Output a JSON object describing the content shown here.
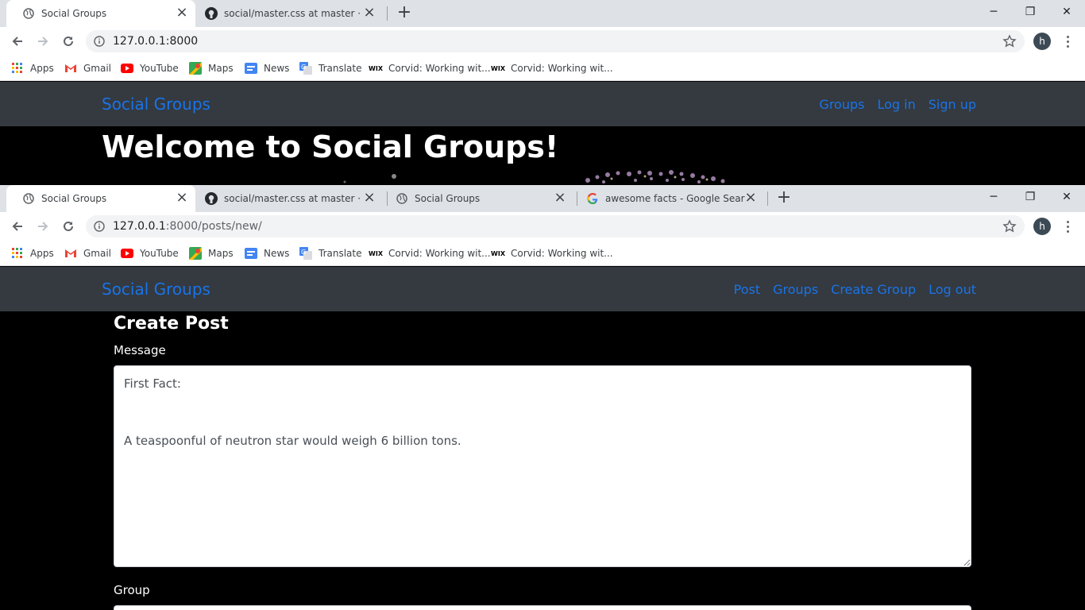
{
  "win1": {
    "tabs": [
      {
        "title": "Social Groups",
        "icon": "globe-icon"
      },
      {
        "title": "social/master.css at master · Him",
        "icon": "github-icon"
      }
    ],
    "url": {
      "host": "127.0.0.1:8000",
      "path": ""
    },
    "site": {
      "brand": "Social Groups",
      "links": [
        "Groups",
        "Log in",
        "Sign up"
      ],
      "hero_title": "Welcome to Social Groups!"
    }
  },
  "win2": {
    "tabs": [
      {
        "title": "Social Groups",
        "icon": "globe-icon"
      },
      {
        "title": "social/master.css at master · Him",
        "icon": "github-icon"
      },
      {
        "title": "Social Groups",
        "icon": "globe-icon"
      },
      {
        "title": "awesome facts - Google Search",
        "icon": "google-icon"
      }
    ],
    "url": {
      "host": "127.0.0.1",
      "path": ":8000/posts/new/"
    },
    "site": {
      "brand": "Social Groups",
      "links": [
        "Post",
        "Groups",
        "Create Group",
        "Log out"
      ]
    },
    "form": {
      "title": "Create Post",
      "message_label": "Message",
      "message_value": "First Fact:\n\n\nA teaspoonful of neutron star would weigh 6 billion tons.",
      "group_label": "Group"
    }
  },
  "bookmarks": [
    "Apps",
    "Gmail",
    "YouTube",
    "Maps",
    "News",
    "Translate",
    "Corvid: Working wit...",
    "Corvid: Working wit..."
  ],
  "profile_initial": "h",
  "colors": {
    "link": "#1a73e8",
    "navbar": "#343a40",
    "tabstrip": "#dee1e6"
  }
}
